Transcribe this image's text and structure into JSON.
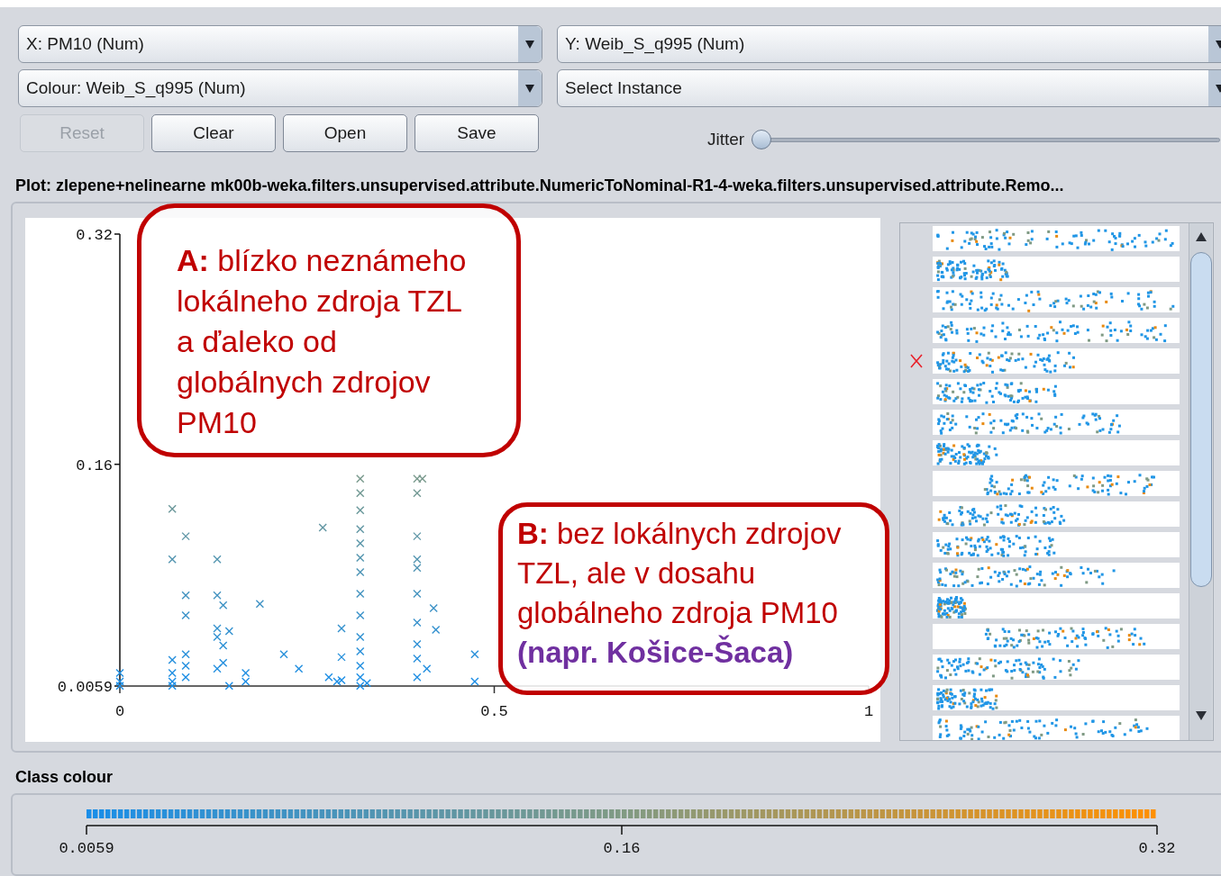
{
  "combos": [
    {
      "text": "X: PM10 (Num)"
    },
    {
      "text": "Y: Weib_S_q995 (Num)"
    },
    {
      "text": "Colour: Weib_S_q995 (Num)"
    },
    {
      "text": "Select Instance"
    }
  ],
  "buttons": [
    {
      "label": "Reset",
      "disabled": true
    },
    {
      "label": "Clear",
      "disabled": false
    },
    {
      "label": "Open",
      "disabled": false
    },
    {
      "label": "Save",
      "disabled": false
    }
  ],
  "jitter": {
    "label": "Jitter",
    "level": 0
  },
  "plot_title": "Plot: zlepene+nelinearne mk00b-weka.filters.unsupervised.attribute.NumericToNominal-R1-4-weka.filters.unsupervised.attribute.Remo...",
  "plot": {
    "chart_data": {
      "type": "scatter",
      "xlim": [
        0,
        1
      ],
      "ylim": [
        0.0059,
        0.32
      ],
      "xticks": [
        0,
        0.5,
        1
      ],
      "yticks": [
        0.0059,
        0.16,
        0.32
      ],
      "x": [
        0,
        0,
        0,
        0.07,
        0.07,
        0.07,
        0.07,
        0.07,
        0.07,
        0.088,
        0.088,
        0.088,
        0.088,
        0.088,
        0.088,
        0.13,
        0.13,
        0.13,
        0.13,
        0.13,
        0.138,
        0.138,
        0.138,
        0.146,
        0.146,
        0.168,
        0.168,
        0.187,
        0.219,
        0.239,
        0.271,
        0.279,
        0.29,
        0.296,
        0.296,
        0.296,
        0.321,
        0.321,
        0.321,
        0.321,
        0.321,
        0.321,
        0.321,
        0.321,
        0.321,
        0.321,
        0.321,
        0.321,
        0.321,
        0.321,
        0.33,
        0.397,
        0.397,
        0.397,
        0.397,
        0.397,
        0.397,
        0.397,
        0.397,
        0.397,
        0.397,
        0.404,
        0.41,
        0.419,
        0.422,
        0.474,
        0.474
      ],
      "series": [
        {
          "values": [
            0.015,
            0.009,
            0.006,
            0.129,
            0.094,
            0.024,
            0.015,
            0.009,
            0.006,
            0.11,
            0.069,
            0.055,
            0.028,
            0.02,
            0.012,
            0.094,
            0.069,
            0.046,
            0.04,
            0.018,
            0.062,
            0.034,
            0.022,
            0.006,
            0.044,
            0.009,
            0.015,
            0.063,
            0.028,
            0.018,
            0.116,
            0.012,
            0.009,
            0.046,
            0.026,
            0.01,
            0.15,
            0.14,
            0.128,
            0.115,
            0.105,
            0.095,
            0.085,
            0.07,
            0.055,
            0.04,
            0.03,
            0.02,
            0.012,
            0.006,
            0.008,
            0.15,
            0.14,
            0.11,
            0.094,
            0.088,
            0.07,
            0.05,
            0.035,
            0.025,
            0.012,
            0.15,
            0.018,
            0.06,
            0.045,
            0.028,
            0.009
          ]
        }
      ]
    }
  },
  "callouts": [
    {
      "lines": [
        "**A:** blízko neznámeho",
        "lokálneho zdroja TZL",
        "a ďaleko od",
        "globálnych zdrojov",
        "PM10"
      ]
    },
    {
      "lines": [
        "**B:** bez lokálnych zdrojov",
        "TZL, ale v dosahu",
        "globálneho zdroja PM10"
      ],
      "note": "(napr. Košice-Šaca)"
    }
  ],
  "thumbnails": [
    {
      "selected": false
    },
    {
      "selected": false
    },
    {
      "selected": false
    },
    {
      "selected": false
    },
    {
      "selected": true
    },
    {
      "selected": false
    },
    {
      "selected": false
    },
    {
      "selected": false
    },
    {
      "selected": false
    },
    {
      "selected": false
    },
    {
      "selected": false
    },
    {
      "selected": false
    },
    {
      "selected": false
    },
    {
      "selected": false
    },
    {
      "selected": false
    },
    {
      "selected": false
    },
    {
      "selected": false
    }
  ],
  "class_colour": {
    "title": "Class colour",
    "ticks": [
      "0.0059",
      "0.16",
      "0.32"
    ]
  }
}
